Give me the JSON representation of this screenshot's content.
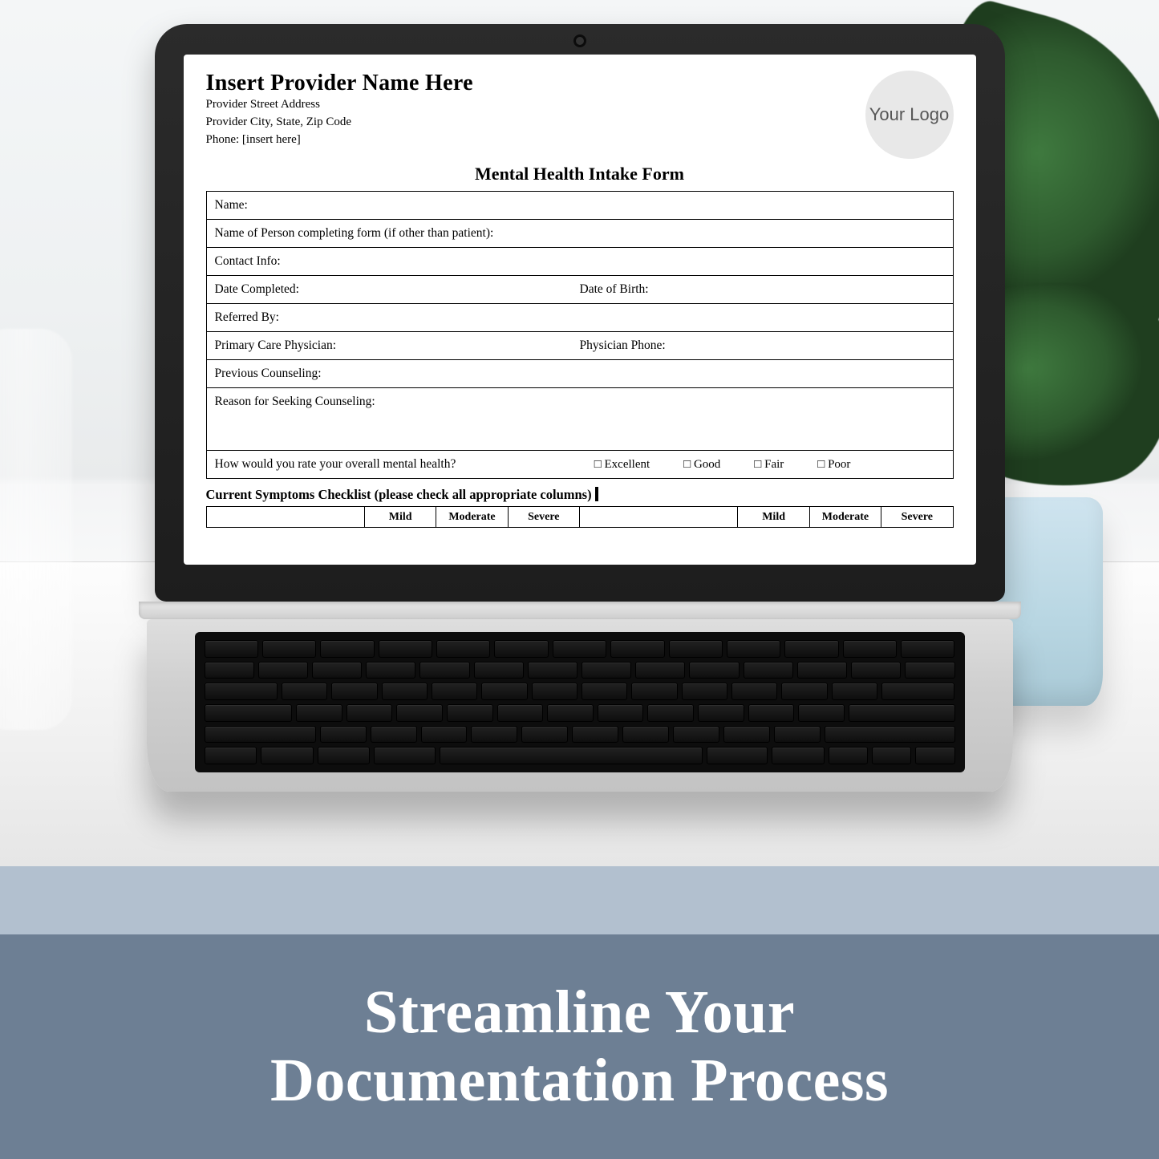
{
  "banner": {
    "tagline_l1": "Streamline Your",
    "tagline_l2": "Documentation Process"
  },
  "document": {
    "provider_name": "Insert Provider Name Here",
    "provider_street": "Provider Street Address",
    "provider_city": "Provider City, State, Zip Code",
    "provider_phone": "Phone: [insert here]",
    "logo_text": "Your Logo",
    "title": "Mental Health Intake Form",
    "fields": {
      "name": "Name:",
      "completer": "Name of Person completing form (if other than patient):",
      "contact": "Contact Info:",
      "date_completed": "Date Completed:",
      "dob": "Date of Birth:",
      "referred": "Referred By:",
      "pcp": "Primary Care Physician:",
      "pcp_phone": "Physician Phone:",
      "prev_counseling": "Previous Counseling:",
      "reason": "Reason for Seeking Counseling:",
      "rating_q": "How would you rate your overall mental health?"
    },
    "rating_options": [
      "Excellent",
      "Good",
      "Fair",
      "Poor"
    ],
    "checklist_title": "Current Symptoms Checklist (please check all appropriate columns)",
    "severity_headers": [
      "Mild",
      "Moderate",
      "Severe"
    ]
  }
}
